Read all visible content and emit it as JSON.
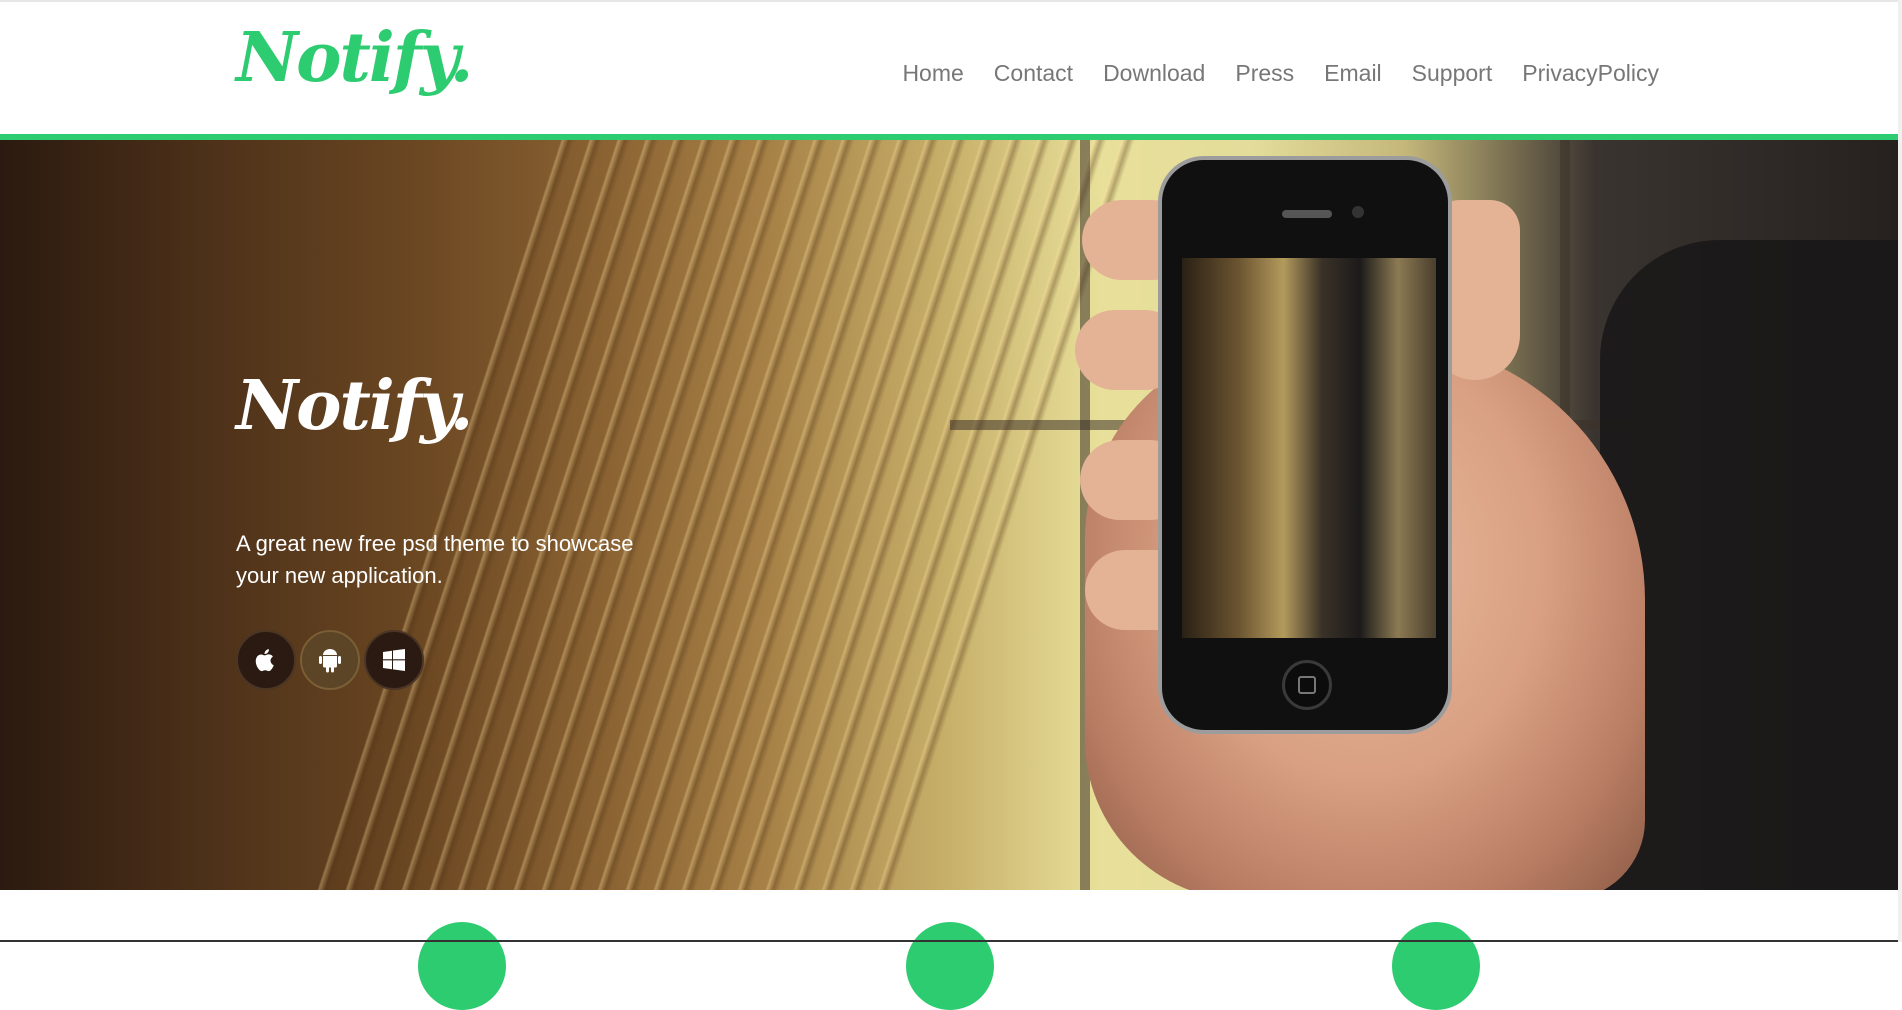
{
  "brand": {
    "logo_text": "Notify.",
    "accent_color": "#2ecc71"
  },
  "nav": {
    "items": [
      {
        "label": "Home"
      },
      {
        "label": "Contact"
      },
      {
        "label": "Download"
      },
      {
        "label": "Press"
      },
      {
        "label": "Email"
      },
      {
        "label": "Support"
      },
      {
        "label": "PrivacyPolicy"
      }
    ]
  },
  "hero": {
    "logo_text": "Notify.",
    "tagline": "A great new free psd theme to showcase your new application.",
    "store_buttons": [
      {
        "icon": "apple-icon"
      },
      {
        "icon": "android-icon"
      },
      {
        "icon": "windows-icon"
      }
    ]
  },
  "features": {
    "circle_color": "#2ecc71"
  }
}
